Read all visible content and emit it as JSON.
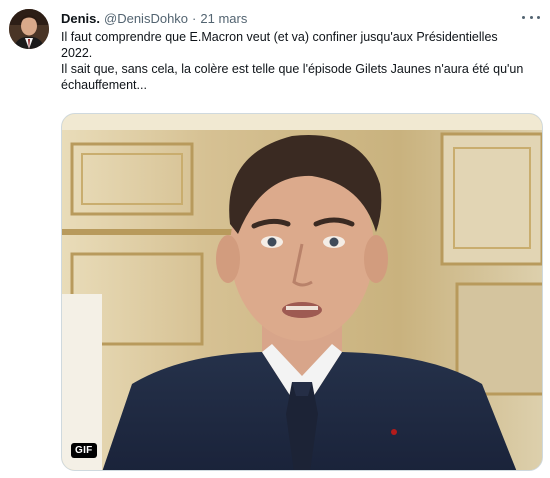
{
  "tweet": {
    "display_name": "Denis.",
    "handle": "@DenisDohko",
    "separator": "·",
    "date": "21 mars",
    "text_lines": [
      "Il faut comprendre que E.Macron veut (et va) confiner jusqu'aux Présidentielles 2022.",
      "Il sait que, sans cela, la colère est telle que l'épisode Gilets Jaunes n'aura été qu'un échauffement..."
    ],
    "media": {
      "badge": "GIF"
    },
    "icons": {
      "more": "more-horizontal-icon",
      "avatar": "avatar"
    }
  },
  "colors": {
    "text": "#0f1419",
    "secondary": "#536471",
    "border": "#cfd9de"
  }
}
